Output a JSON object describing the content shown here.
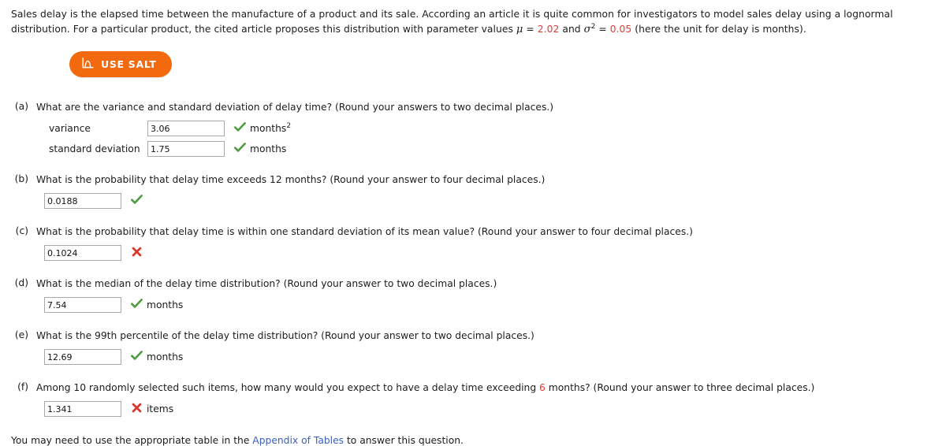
{
  "intro": {
    "part1": "Sales delay is the elapsed time between the manufacture of a product and its sale. According an article it is quite common for investigators to model sales delay using a lognormal distribution. For a particular product, the cited article proposes this distribution with parameter values ",
    "mu_symbol": "μ",
    "equals1": " = ",
    "mu_value": "2.02",
    "and": " and ",
    "sigma_symbol": "σ",
    "sigma_exp": "2",
    "equals2": " = ",
    "sigma_value": "0.05",
    "part2": " (here the unit for delay is months)."
  },
  "salt_button": {
    "label": "USE SALT",
    "icon": "distribution-chart-icon",
    "color": "#f26a0d"
  },
  "colors": {
    "red_value": "#e8392f",
    "correct_mark": "#4f9b41",
    "incorrect_mark": "#d9362d",
    "link": "#3b5fc0"
  },
  "questions": [
    {
      "label": "(a)",
      "text": "What are the variance and standard deviation of delay time? (Round your answers to two decimal places.)",
      "answers": [
        {
          "name": "variance",
          "value": "3.06",
          "mark": "correct",
          "unit": "months",
          "unit_sup": "2"
        },
        {
          "name": "standard deviation",
          "value": "1.75",
          "mark": "correct",
          "unit": "months",
          "unit_sup": ""
        }
      ]
    },
    {
      "label": "(b)",
      "text": "What is the probability that delay time exceeds 12 months? (Round your answer to four decimal places.)",
      "answers": [
        {
          "name": "",
          "value": "0.0188",
          "mark": "correct",
          "unit": "",
          "unit_sup": ""
        }
      ]
    },
    {
      "label": "(c)",
      "text": "What is the probability that delay time is within one standard deviation of its mean value? (Round your answer to four decimal places.)",
      "answers": [
        {
          "name": "",
          "value": "0.1024",
          "mark": "incorrect",
          "unit": "",
          "unit_sup": ""
        }
      ]
    },
    {
      "label": "(d)",
      "text": "What is the median of the delay time distribution? (Round your answer to two decimal places.)",
      "answers": [
        {
          "name": "",
          "value": "7.54",
          "mark": "correct",
          "unit": "months",
          "unit_sup": ""
        }
      ]
    },
    {
      "label": "(e)",
      "text": "What is the 99th percentile of the delay time distribution? (Round your answer to two decimal places.)",
      "answers": [
        {
          "name": "",
          "value": "12.69",
          "mark": "correct",
          "unit": "months",
          "unit_sup": ""
        }
      ]
    },
    {
      "label": "(f)",
      "text_before": "Among 10 randomly selected such items, how many would you expect to have a delay time exceeding ",
      "highlight": "6",
      "text_after": " months? (Round your answer to three decimal places.)",
      "answers": [
        {
          "name": "",
          "value": "1.341",
          "mark": "incorrect",
          "unit": "items",
          "unit_sup": ""
        }
      ]
    }
  ],
  "footer": {
    "before": "You may need to use the appropriate table in the ",
    "link": "Appendix of Tables",
    "after": " to answer this question."
  }
}
